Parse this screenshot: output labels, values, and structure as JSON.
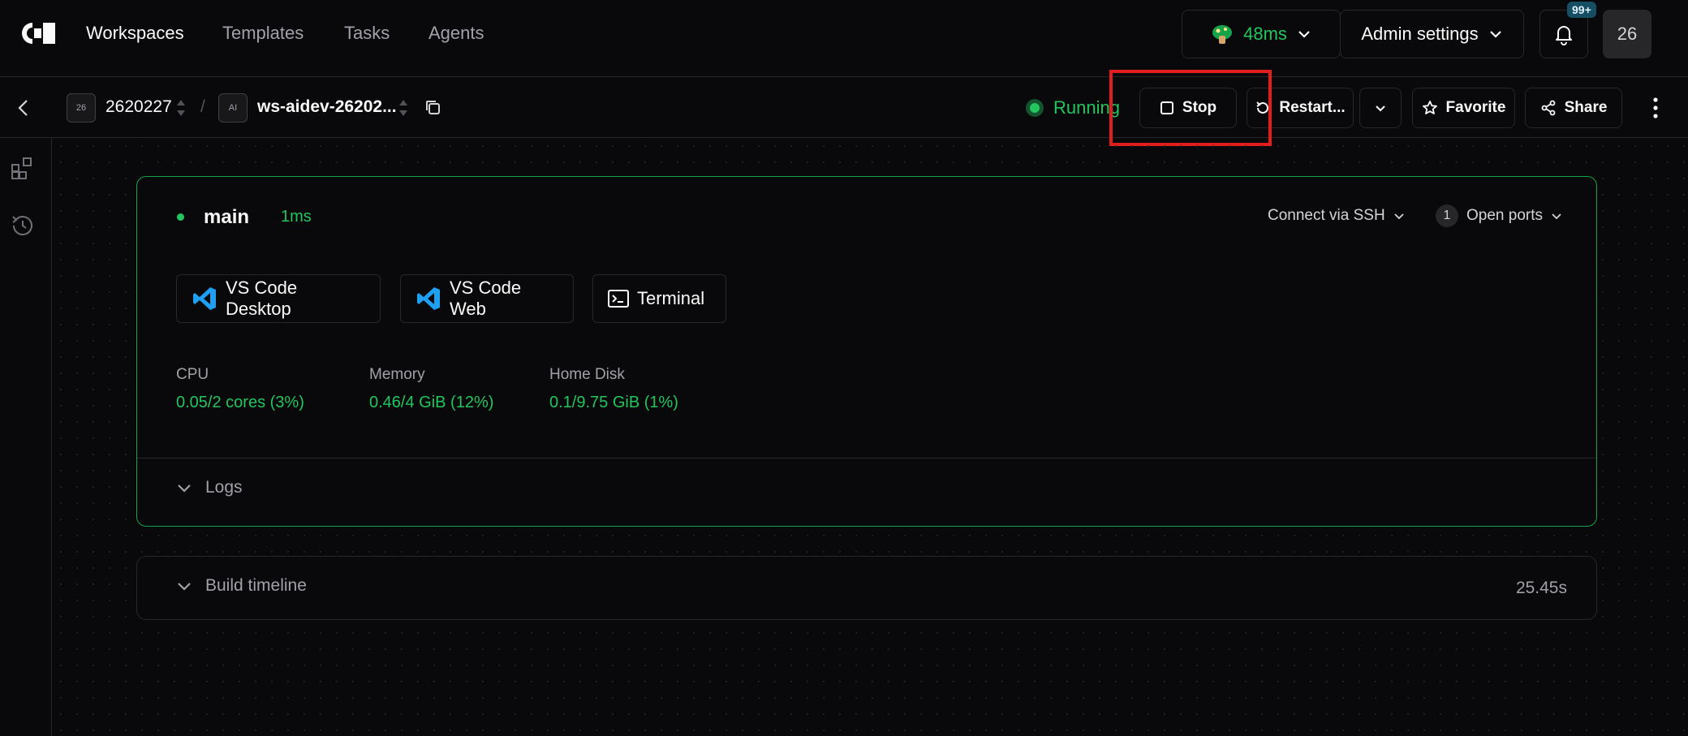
{
  "nav": {
    "links": [
      "Workspaces",
      "Templates",
      "Tasks",
      "Agents"
    ],
    "latency": "48ms",
    "admin_settings": "Admin settings",
    "notification_badge": "99+",
    "avatar_label": "26"
  },
  "breadcrumb": {
    "org_badge": "26",
    "org_name": "2620227",
    "separator": "/",
    "ws_badge": "AI",
    "ws_name": "ws-aidev-26202..."
  },
  "actions": {
    "status": "Running",
    "stop": "Stop",
    "restart": "Restart...",
    "favorite": "Favorite",
    "share": "Share"
  },
  "agent": {
    "name": "main",
    "latency": "1ms",
    "connect_ssh": "Connect via SSH",
    "open_ports_count": "1",
    "open_ports": "Open ports",
    "apps": [
      "VS Code Desktop",
      "VS Code Web",
      "Terminal"
    ],
    "metrics": [
      {
        "label": "CPU",
        "value": "0.05/2 cores (3%)"
      },
      {
        "label": "Memory",
        "value": "0.46/4 GiB (12%)"
      },
      {
        "label": "Home Disk",
        "value": "0.1/9.75 GiB (1%)"
      }
    ],
    "logs": "Logs"
  },
  "timeline": {
    "label": "Build timeline",
    "duration": "25.45s"
  },
  "colors": {
    "accent_green": "#22c55e",
    "highlight_red": "#e11d1d",
    "vscode_blue": "#1e9ff2"
  }
}
